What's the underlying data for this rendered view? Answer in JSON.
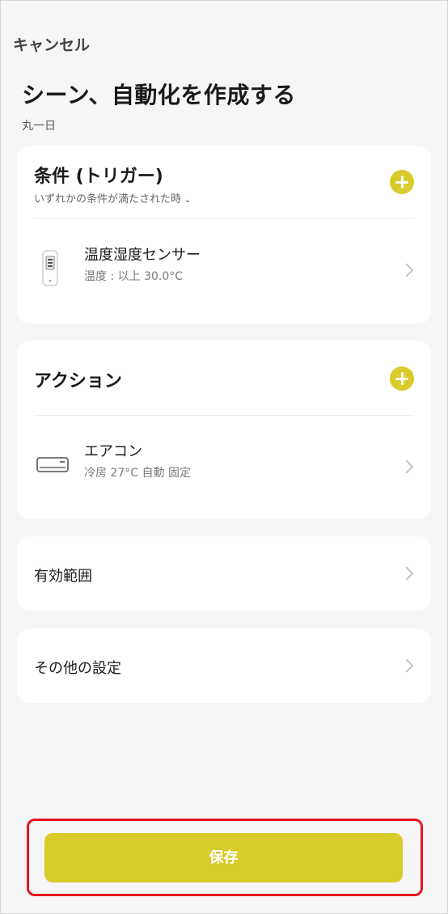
{
  "header": {
    "cancel_label": "キャンセル",
    "title": "シーン、自動化を作成する",
    "subtitle": "丸一日"
  },
  "trigger_section": {
    "title": "条件 (トリガー)",
    "subtitle": "いずれかの条件が満たされた時",
    "subtitle_icon": "chevron-down-icon",
    "items": [
      {
        "icon": "thermometer-sensor-icon",
        "name": "温度湿度センサー",
        "description": "温度 : 以上 30.0°C"
      }
    ]
  },
  "action_section": {
    "title": "アクション",
    "items": [
      {
        "icon": "air-conditioner-icon",
        "name": "エアコン",
        "description": "冷房 27°C 自動 固定"
      }
    ]
  },
  "scope": {
    "label": "有効範囲"
  },
  "other_settings": {
    "label": "その他の設定"
  },
  "save_button": {
    "label": "保存"
  },
  "colors": {
    "accent": "#d9cb2a",
    "background": "#f6f6f6",
    "card": "#ffffff",
    "highlight_outline": "#e5141f"
  }
}
